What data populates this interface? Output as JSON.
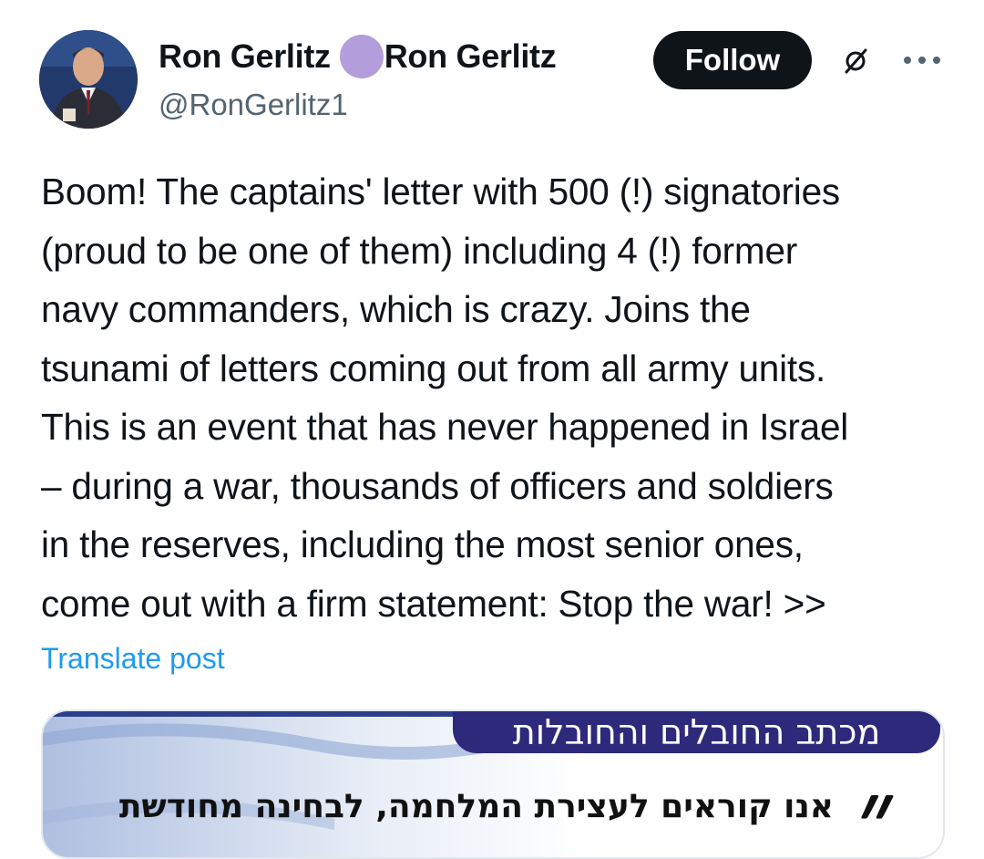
{
  "author": {
    "display_name": "Ron Gerlitz",
    "display_name_suffix": "Ron Gerlitz",
    "handle": "@RonGerlitz1",
    "avatar": "profile-photo",
    "badge_color": "#b39ddb"
  },
  "actions": {
    "follow_label": "Follow",
    "grok_icon": "grok-slash-icon",
    "more_icon": "more-dots-icon"
  },
  "tweet": {
    "lines": [
      "Boom! The captains' letter with 500 (!) signatories",
      "(proud to be one of them) including 4 (!) former",
      "navy commanders, which is crazy. Joins the",
      "tsunami of letters coming out from all army units.",
      "This is an event that has never happened in Israel",
      "– during a war, thousands of officers and soldiers",
      "in the reserves, including the most senior ones,",
      "come out with a firm statement: Stop the war! >>"
    ],
    "translate_label": "Translate post"
  },
  "media": {
    "title": "מכתב החובלים והחובלות",
    "subtitle": "אנו קוראים לעצירת המלחמה, לבחינה מחודשת",
    "quote_mark": "״"
  },
  "colors": {
    "text": "#0f1419",
    "secondary": "#536471",
    "link": "#1d9bf0",
    "button_bg": "#0f1419",
    "banner": "#2d2a7c"
  }
}
